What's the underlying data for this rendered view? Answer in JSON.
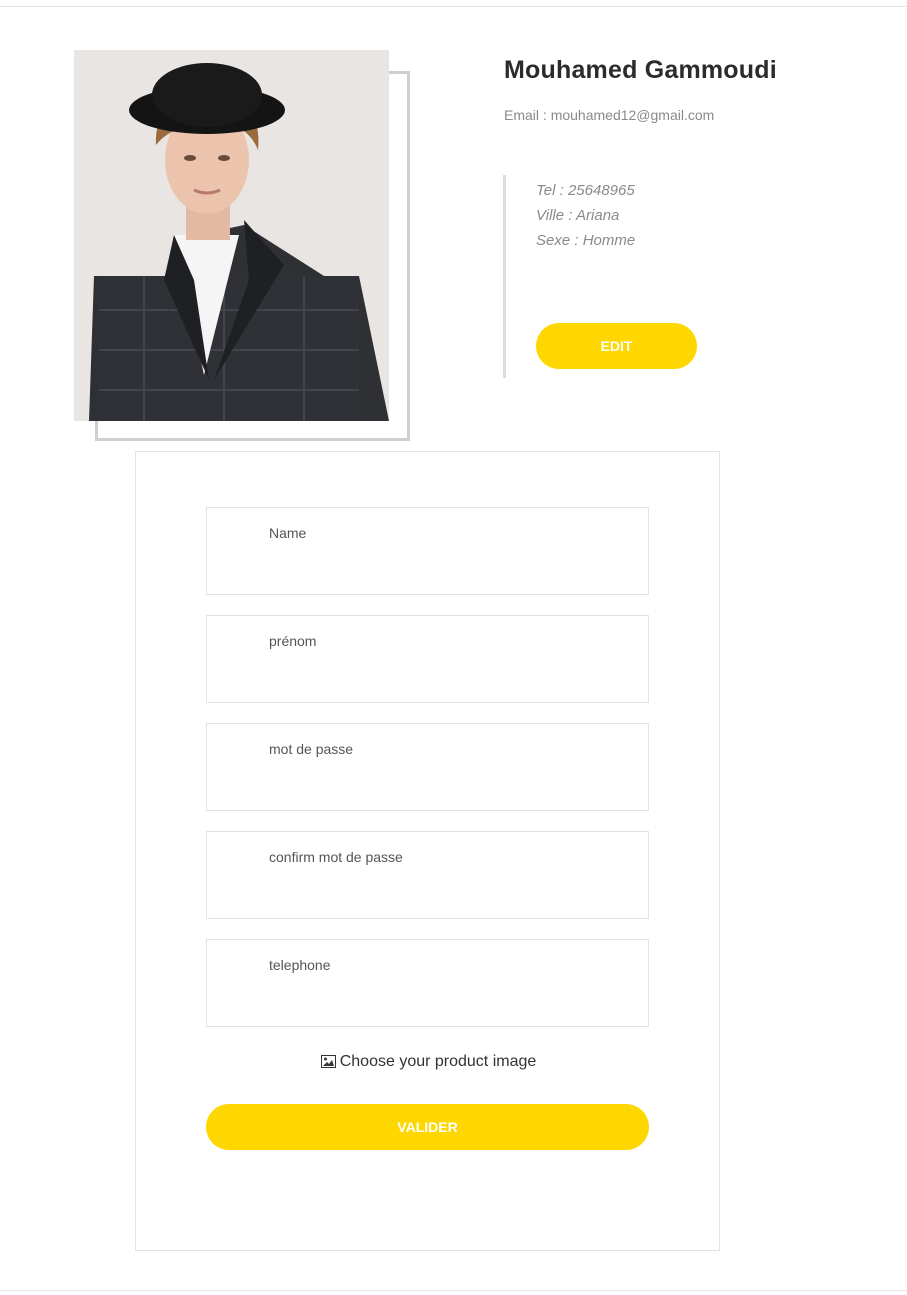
{
  "profile": {
    "name": "Mouhamed Gammoudi",
    "email_label": "Email :",
    "email": "mouhamed12@gmail.com",
    "details": [
      "Tel : 25648965",
      "Ville : Ariana",
      "Sexe : Homme"
    ],
    "edit_label": "EDIT"
  },
  "form": {
    "fields": [
      {
        "label": "Name",
        "value": ""
      },
      {
        "label": "prénom",
        "value": ""
      },
      {
        "label": "mot de passe",
        "value": ""
      },
      {
        "label": "confirm mot de passe",
        "value": ""
      },
      {
        "label": "telephone",
        "value": ""
      }
    ],
    "image_picker_label": "Choose your product image",
    "image_picker_icon": "image-icon",
    "submit_label": "VALIDER"
  },
  "colors": {
    "accent": "#ffd700",
    "button_text": "#ffffff",
    "muted_text": "#8a8a8a",
    "border": "#e3e3e3"
  }
}
